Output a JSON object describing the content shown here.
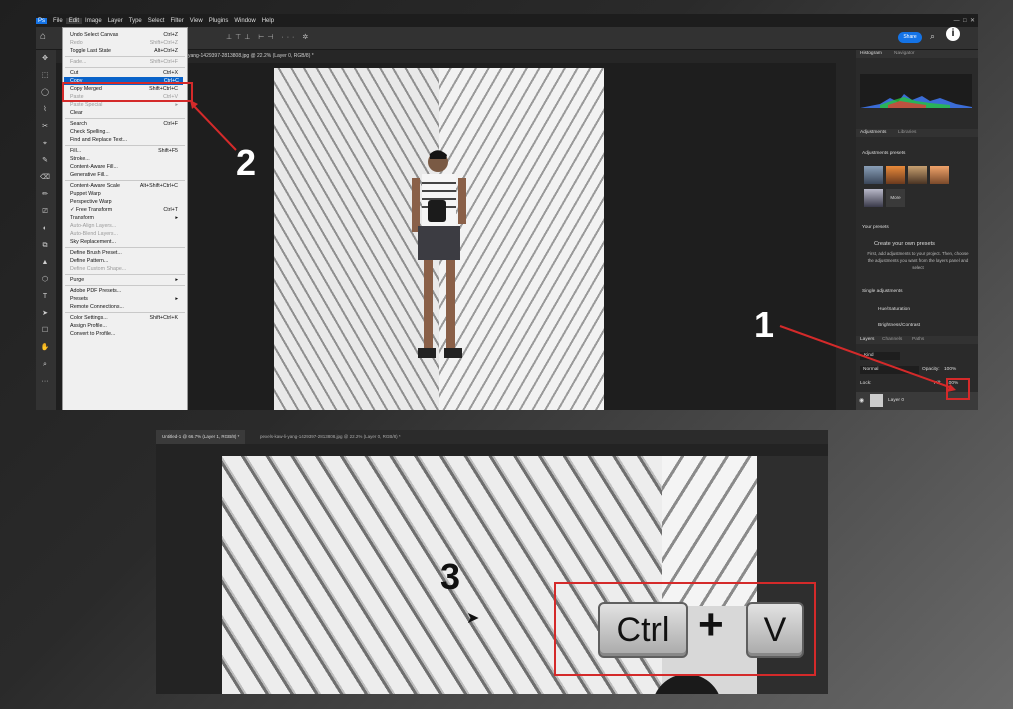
{
  "menubar": [
    "File",
    "Edit",
    "Image",
    "Layer",
    "Type",
    "Select",
    "Filter",
    "View",
    "Plugins",
    "Window",
    "Help"
  ],
  "share_label": "Share",
  "doc_tab1": "yang-1429397-2813808.jpg @ 22.2% (Layer 0, RGB/8) *",
  "edit_menu": [
    {
      "label": "Undo Select Canvas",
      "key": "Ctrl+Z",
      "dis": false
    },
    {
      "label": "Redo",
      "key": "Shift+Ctrl+Z",
      "dis": true
    },
    {
      "label": "Toggle Last State",
      "key": "Alt+Ctrl+Z",
      "dis": false
    },
    {
      "sep": true
    },
    {
      "label": "Fade...",
      "key": "Shift+Ctrl+F",
      "dis": true
    },
    {
      "sep": true
    },
    {
      "label": "Cut",
      "key": "Ctrl+X",
      "dis": false
    },
    {
      "label": "Copy",
      "key": "Ctrl+C",
      "dis": false,
      "hl": true
    },
    {
      "label": "Copy Merged",
      "key": "Shift+Ctrl+C",
      "dis": false
    },
    {
      "label": "Paste",
      "key": "Ctrl+V",
      "dis": true
    },
    {
      "label": "Paste Special",
      "key": "▸",
      "dis": true
    },
    {
      "label": "Clear",
      "key": "",
      "dis": false
    },
    {
      "sep": true
    },
    {
      "label": "Search",
      "key": "Ctrl+F",
      "dis": false
    },
    {
      "label": "Check Spelling...",
      "key": "",
      "dis": false
    },
    {
      "label": "Find and Replace Text...",
      "key": "",
      "dis": false
    },
    {
      "sep": true
    },
    {
      "label": "Fill...",
      "key": "Shift+F5",
      "dis": false
    },
    {
      "label": "Stroke...",
      "key": "",
      "dis": false
    },
    {
      "label": "Content-Aware Fill...",
      "key": "",
      "dis": false
    },
    {
      "label": "Generative Fill...",
      "key": "",
      "dis": false
    },
    {
      "sep": true
    },
    {
      "label": "Content-Aware Scale",
      "key": "Alt+Shift+Ctrl+C",
      "dis": false
    },
    {
      "label": "Puppet Warp",
      "key": "",
      "dis": false
    },
    {
      "label": "Perspective Warp",
      "key": "",
      "dis": false
    },
    {
      "label": "✓ Free Transform",
      "key": "Ctrl+T",
      "dis": false
    },
    {
      "label": "Transform",
      "key": "▸",
      "dis": false
    },
    {
      "label": "Auto-Align Layers...",
      "key": "",
      "dis": true
    },
    {
      "label": "Auto-Blend Layers...",
      "key": "",
      "dis": true
    },
    {
      "label": "Sky Replacement...",
      "key": "",
      "dis": false
    },
    {
      "sep": true
    },
    {
      "label": "Define Brush Preset...",
      "key": "",
      "dis": false
    },
    {
      "label": "Define Pattern...",
      "key": "",
      "dis": false
    },
    {
      "label": "Define Custom Shape...",
      "key": "",
      "dis": true
    },
    {
      "sep": true
    },
    {
      "label": "Purge",
      "key": "▸",
      "dis": false
    },
    {
      "sep": true
    },
    {
      "label": "Adobe PDF Presets...",
      "key": "",
      "dis": false
    },
    {
      "label": "Presets",
      "key": "▸",
      "dis": false
    },
    {
      "label": "Remote Connections...",
      "key": "",
      "dis": false
    },
    {
      "sep": true
    },
    {
      "label": "Color Settings...",
      "key": "Shift+Ctrl+K",
      "dis": false
    },
    {
      "label": "Assign Profile...",
      "key": "",
      "dis": false
    },
    {
      "label": "Convert to Profile...",
      "key": "",
      "dis": false
    }
  ],
  "panels": {
    "histogram_tab": "Histogram",
    "navigator_tab": "Navigator",
    "adjustments_tab": "Adjustments",
    "libraries_tab": "Libraries",
    "adjustments_presets": "Adjustments presets",
    "more_label": "More",
    "your_presets": "Your presets",
    "create_title": "Create your own presets",
    "create_desc": "First, add adjustments to your project. Then, choose the adjustments you want from the layers panel and select",
    "single_adjustments": "Single adjustments",
    "hue_saturation": "Hue/Saturation",
    "brightness_contrast": "Brightness/Contrast",
    "layers_tab": "Layers",
    "channels_tab": "Channels",
    "paths_tab": "Paths",
    "kind_label": "Kind",
    "blend_mode": "Normal",
    "opacity_label": "Opacity:",
    "opacity_value": "100%",
    "lock_label": "Lock:",
    "fill_label": "Fill:",
    "fill_value": "100%",
    "layer_name": "Layer 0"
  },
  "doc_tab2a": "Untitled-1 @ 66.7% (Layer 1, RGB/8) *",
  "doc_tab2b": "pexels-kaw-li-yang-1429397-2813808.jpg @ 22.2% (Layer 0, RGB/8) *",
  "annotations": {
    "n1": "1",
    "n2": "2",
    "n3": "3",
    "key_ctrl": "Ctrl",
    "plus": "+",
    "key_v": "V"
  },
  "colors": {
    "highlight": "#0a63c9",
    "annotation_red": "#d42a2a",
    "share_blue": "#1473e6"
  }
}
